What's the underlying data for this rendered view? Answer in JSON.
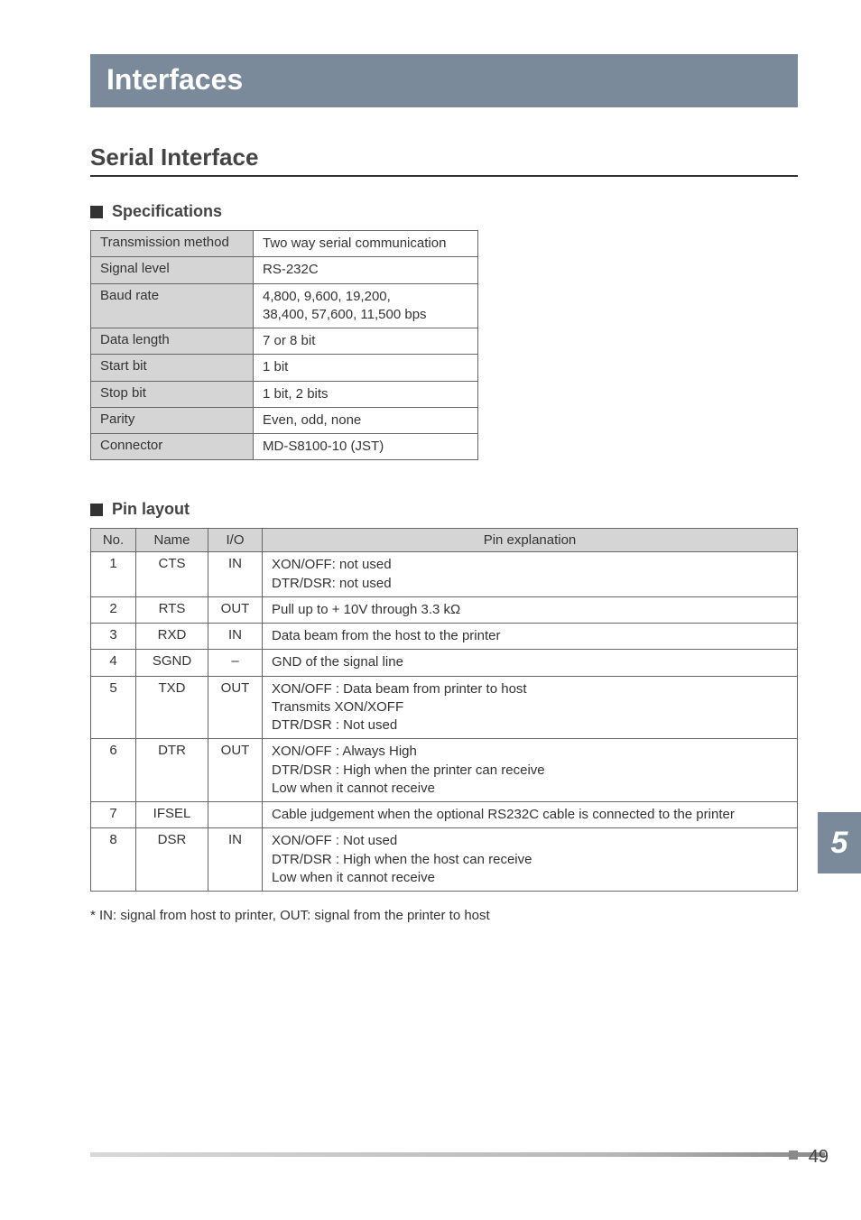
{
  "title": "Interfaces",
  "section": "Serial Interface",
  "sub_spec": "Specifications",
  "sub_pin": "Pin layout",
  "spec_rows": [
    {
      "k": "Transmission method",
      "v": "Two way serial communication"
    },
    {
      "k": "Signal level",
      "v": "RS-232C"
    },
    {
      "k": "Baud rate",
      "v": "4,800, 9,600, 19,200,\n38,400, 57,600, 11,500 bps"
    },
    {
      "k": "Data length",
      "v": "7 or 8 bit"
    },
    {
      "k": "Start bit",
      "v": "1 bit"
    },
    {
      "k": "Stop bit",
      "v": "1 bit, 2 bits"
    },
    {
      "k": "Parity",
      "v": "Even, odd, none"
    },
    {
      "k": "Connector",
      "v": "MD-S8100-10 (JST)"
    }
  ],
  "pin_headers": {
    "no": "No.",
    "name": "Name",
    "io": "I/O",
    "expl": "Pin explanation"
  },
  "pin_rows": [
    {
      "no": "1",
      "name": "CTS",
      "io": "IN",
      "expl": "XON/OFF:   not used\nDTR/DSR:   not used"
    },
    {
      "no": "2",
      "name": "RTS",
      "io": "OUT",
      "expl": "Pull up to + 10V through 3.3 kΩ"
    },
    {
      "no": "3",
      "name": "RXD",
      "io": "IN",
      "expl": "Data beam from the host to the printer"
    },
    {
      "no": "4",
      "name": "SGND",
      "io": "–",
      "expl": "GND of the signal line"
    },
    {
      "no": "5",
      "name": "TXD",
      "io": "OUT",
      "expl": "XON/OFF :  Data beam from printer to host\n                   Transmits XON/XOFF\nDTR/DSR :  Not used"
    },
    {
      "no": "6",
      "name": "DTR",
      "io": "OUT",
      "expl": "XON/OFF :  Always High\nDTR/DSR :  High when the printer can receive\n                   Low when it cannot receive"
    },
    {
      "no": "7",
      "name": "IFSEL",
      "io": "",
      "expl": "Cable judgement when the optional RS232C cable is connected to the printer"
    },
    {
      "no": "8",
      "name": "DSR",
      "io": "IN",
      "expl": "XON/OFF :  Not used\nDTR/DSR :  High when the host can receive\n                   Low when it cannot receive"
    }
  ],
  "footnote": "* IN: signal from host to printer, OUT: signal from the printer to host",
  "chapter": "5",
  "page_num": "49"
}
